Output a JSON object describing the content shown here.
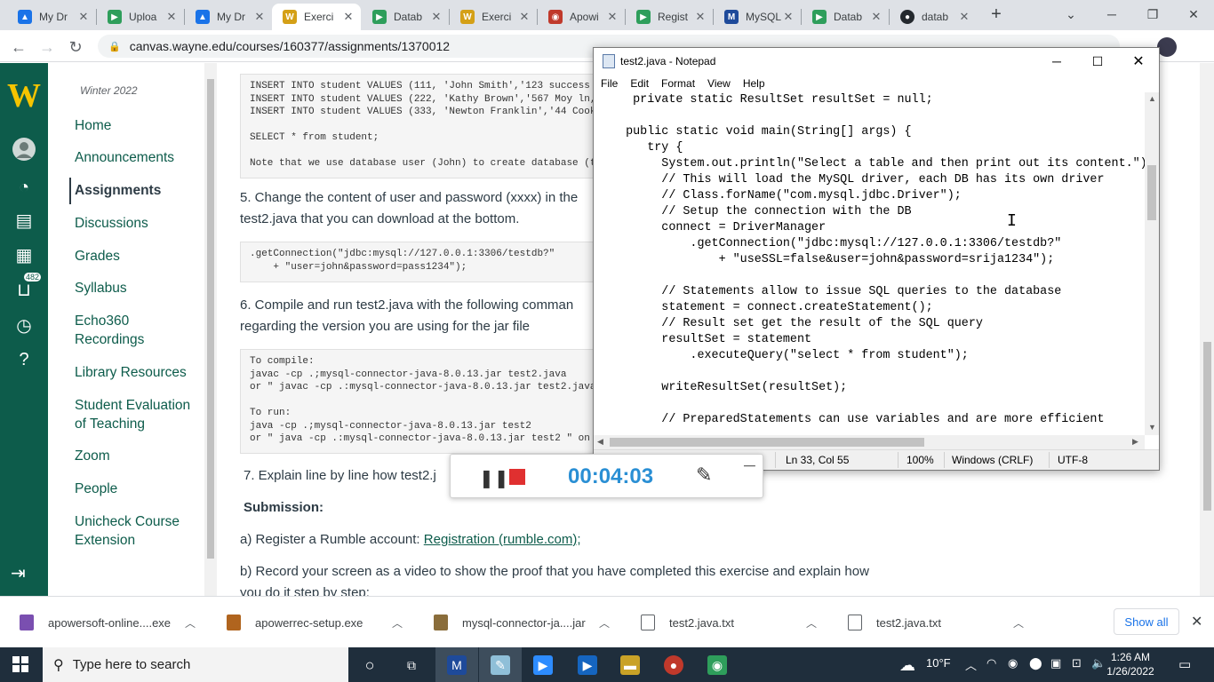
{
  "browser": {
    "tabs": [
      {
        "title": "My Dr",
        "color": "#1a73e8",
        "letter": "▲"
      },
      {
        "title": "Uploa",
        "color": "#2e9e5b",
        "letter": "▶"
      },
      {
        "title": "My Dr",
        "color": "#1a73e8",
        "letter": "▲"
      },
      {
        "title": "Exerci",
        "color": "#d4a017",
        "letter": "W"
      },
      {
        "title": "Datab",
        "color": "#2e9e5b",
        "letter": "▶"
      },
      {
        "title": "Exerci",
        "color": "#d4a017",
        "letter": "W"
      },
      {
        "title": "Apowi",
        "color": "#c0392b",
        "letter": "◉"
      },
      {
        "title": "Regist",
        "color": "#2e9e5b",
        "letter": "▶"
      },
      {
        "title": "MySQL",
        "color": "#1e4a9a",
        "letter": "M"
      },
      {
        "title": "Datab",
        "color": "#2e9e5b",
        "letter": "▶"
      },
      {
        "title": "datab",
        "color": "#24292e",
        "letter": "●"
      }
    ],
    "url": "canvas.wayne.edu/courses/160377/assignments/1370012"
  },
  "course_nav": {
    "term": "Winter 2022",
    "items": [
      "Home",
      "Announcements",
      "Assignments",
      "Discussions",
      "Grades",
      "Syllabus",
      "Echo360 Recordings",
      "Library Resources",
      "Student Evaluation of Teaching",
      "Zoom",
      "People",
      "Unicheck Course Extension"
    ],
    "badge": "482"
  },
  "assignment": {
    "code1": "INSERT INTO student VALUES (111, 'John Smith','123 success\nINSERT INTO student VALUES (222, 'Kathy Brown','567 Moy ln,\nINSERT INTO student VALUES (333, 'Newton Franklin','44 Cook\n\nSELECT * from student;\n\nNote that we use database user (John) to create database (t",
    "step5_line1": "5. Change the content of user and password (xxxx) in the",
    "step5_line2": "test2.java that you can download at the bottom.",
    "code2": ".getConnection(\"jdbc:mysql://127.0.0.1:3306/testdb?\"\n    + \"user=john&password=pass1234\");",
    "step6_line1": "6. Compile and run test2.java with the following comman",
    "step6_line2": "regarding the version you are using for the jar file",
    "code3": "To compile:\njavac -cp .;mysql-connector-java-8.0.13.jar test2.java\nor \" javac -cp .:mysql-connector-java-8.0.13.jar test2.java\n\nTo run:\njava -cp .;mysql-connector-java-8.0.13.jar test2\nor \" java -cp .:mysql-connector-java-8.0.13.jar test2 \" on",
    "step7": "7.  Explain line by line how test2.j",
    "submission": "Submission:",
    "sub_a_prefix": "a) Register a Rumble account: ",
    "sub_a_link": "Registration (rumble.com);",
    "sub_b_line1": "b) Record your screen as a video to show the proof that you have completed this exercise and explain how",
    "sub_b_line2": "you do it step by step:"
  },
  "notepad": {
    "title": "test2.java - Notepad",
    "menu": [
      "File",
      "Edit",
      "Format",
      "View",
      "Help"
    ],
    "content": "    private static ResultSet resultSet = null;\n\n   public static void main(String[] args) {\n      try {\n        System.out.println(\"Select a table and then print out its content.\");\n        // This will load the MySQL driver, each DB has its own driver\n        // Class.forName(\"com.mysql.jdbc.Driver\");\n        // Setup the connection with the DB\n        connect = DriverManager\n            .getConnection(\"jdbc:mysql://127.0.0.1:3306/testdb?\"\n                + \"useSSL=false&user=john&password=srija1234\");\n\n        // Statements allow to issue SQL queries to the database\n        statement = connect.createStatement();\n        // Result set get the result of the SQL query\n        resultSet = statement\n            .executeQuery(\"select * from student\");\n\n        writeResultSet(resultSet);\n\n        // PreparedStatements can use variables and are more efficient",
    "status": {
      "position": "Ln 33, Col 55",
      "zoom": "100%",
      "line_ending": "Windows (CRLF)",
      "encoding": "UTF-8"
    }
  },
  "recorder": {
    "time": "00:04:03"
  },
  "downloads": {
    "items": [
      {
        "name": "apowersoft-online....exe",
        "color": "#7a4fb0"
      },
      {
        "name": "apowerrec-setup.exe",
        "color": "#b0641e"
      },
      {
        "name": "mysql-connector-ja....jar",
        "color": "#8a6d3b"
      },
      {
        "name": "test2.java.txt",
        "color": "#5f6368"
      },
      {
        "name": "test2.java.txt",
        "color": "#5f6368"
      }
    ],
    "show_all": "Show all"
  },
  "taskbar": {
    "search_placeholder": "Type here to search",
    "temperature": "10°F",
    "time": "1:26 AM",
    "date": "1/26/2022"
  }
}
